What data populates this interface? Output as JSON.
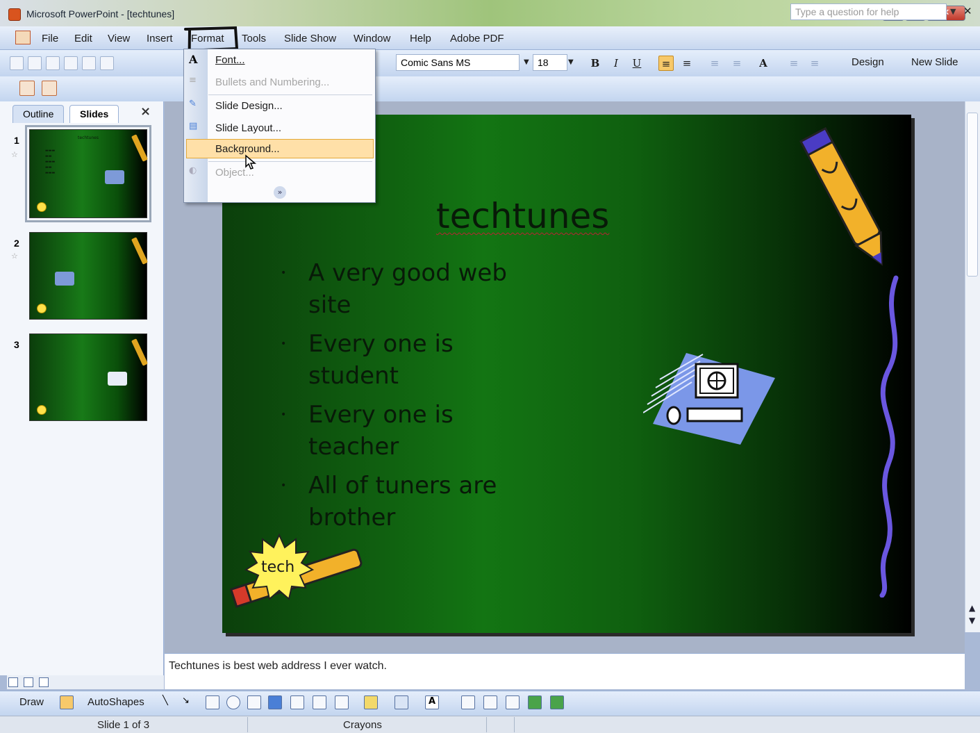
{
  "window": {
    "title": "Microsoft PowerPoint - [techtunes]"
  },
  "menubar": {
    "items": [
      "File",
      "Edit",
      "View",
      "Insert",
      "Format",
      "Tools",
      "Slide Show",
      "Window",
      "Help",
      "Adobe PDF"
    ],
    "help_placeholder": "Type a question for help"
  },
  "toolbar": {
    "font": "Comic Sans MS",
    "size": "18",
    "bold": "B",
    "italic": "I",
    "underline": "U",
    "design_label": "Design",
    "new_slide_label": "New Slide"
  },
  "format_menu": {
    "items": [
      {
        "label": "Font...",
        "disabled": false
      },
      {
        "label": "Bullets and Numbering...",
        "disabled": true
      },
      {
        "label": "Slide Design...",
        "disabled": false
      },
      {
        "label": "Slide Layout...",
        "disabled": false
      },
      {
        "label": "Background...",
        "disabled": false,
        "highlighted": true
      },
      {
        "label": "Object...",
        "disabled": true
      }
    ],
    "expand_glyph": "»"
  },
  "left_pane": {
    "tabs": [
      "Outline",
      "Slides"
    ],
    "close_glyph": "×",
    "slides": [
      {
        "number": "1",
        "selected": true
      },
      {
        "number": "2",
        "selected": false
      },
      {
        "number": "3",
        "selected": false
      }
    ]
  },
  "slide": {
    "title": "techtunes",
    "bullets": [
      "A very good web site",
      "Every one is student",
      "Every one is teacher",
      "All of tuners are brother"
    ],
    "badge_text": "tech",
    "background_colors": [
      "#0b3f0b",
      "#137513",
      "#000000"
    ]
  },
  "notes": {
    "text": "Techtunes is best web address I ever watch."
  },
  "draw_toolbar": {
    "draw_label": "Draw",
    "autoshapes_label": "AutoShapes"
  },
  "status": {
    "slide_info": "Slide 1 of 3",
    "design_template": "Crayons"
  },
  "icons": [
    "app-icon",
    "document-icon",
    "minimize-icon",
    "maximize-icon",
    "close-icon",
    "crayon-icon",
    "computer-clipart-icon",
    "globe-icon",
    "cursor-icon"
  ]
}
